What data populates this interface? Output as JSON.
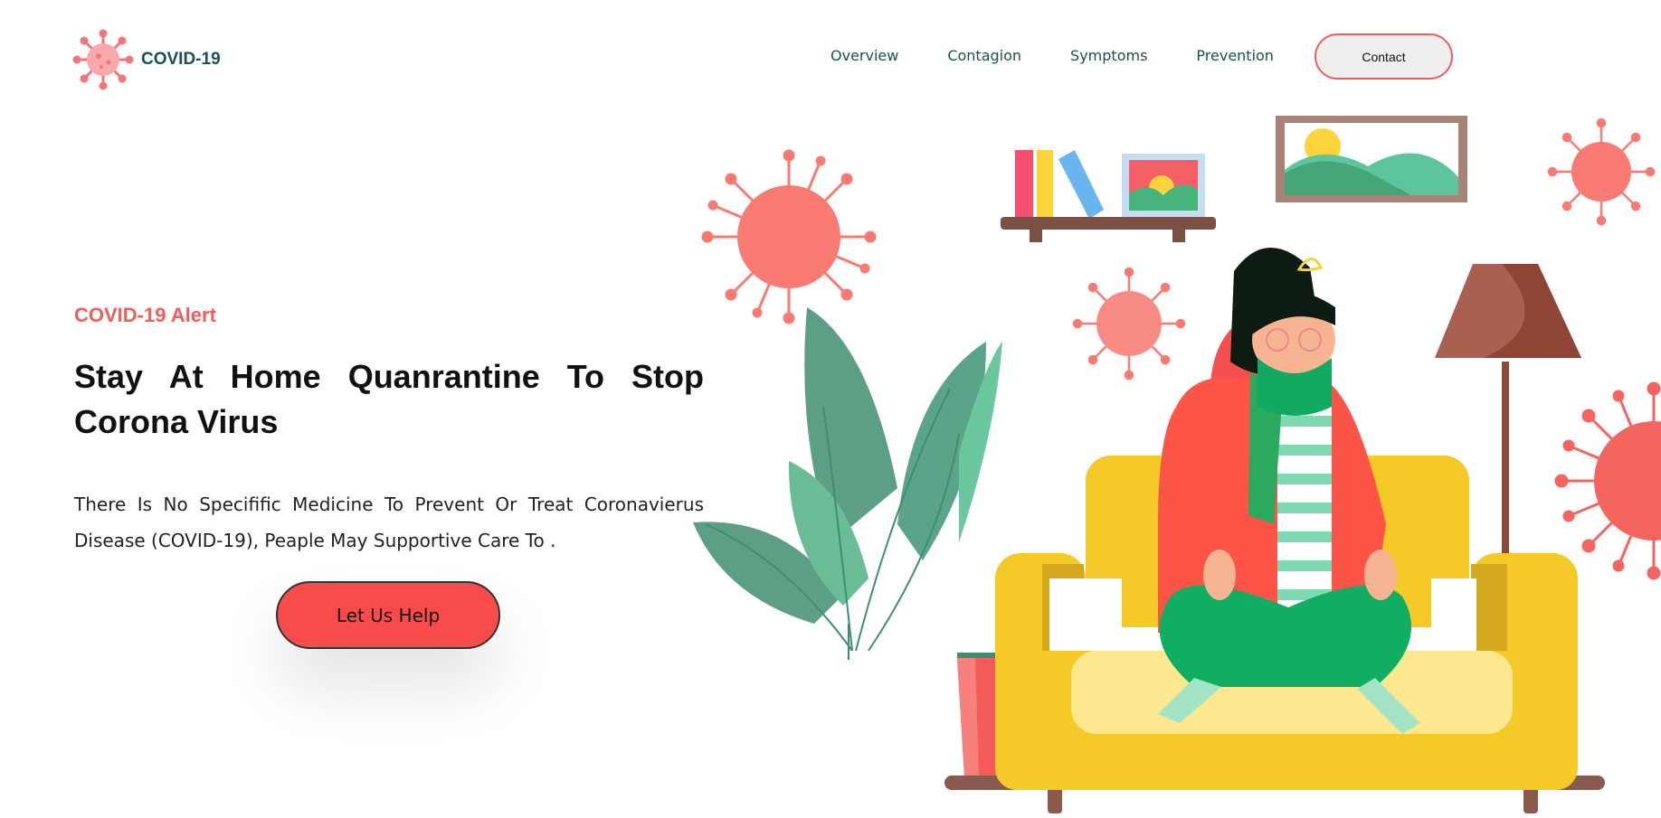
{
  "brand": {
    "name": "COVID-19",
    "icon": "virus-icon"
  },
  "nav": {
    "items": [
      "Overview",
      "Contagion",
      "Symptoms",
      "Prevention"
    ],
    "contact_label": "Contact"
  },
  "hero": {
    "alert": "COVID-19 Alert",
    "headline": "Stay At Home Quanrantine To Stop Corona Virus",
    "description": "There Is No Specifific Medicine To Prevent Or Treat Coronavierus Disease (COVID-19), Peaple May Supportive Care To .",
    "cta_label": "Let Us Help"
  },
  "colors": {
    "accent": "#f25c5c",
    "brand_text": "#1d4f52",
    "sofa": "#f4c928",
    "leaf": "#5cc59b",
    "scarf": "#12aa61"
  }
}
